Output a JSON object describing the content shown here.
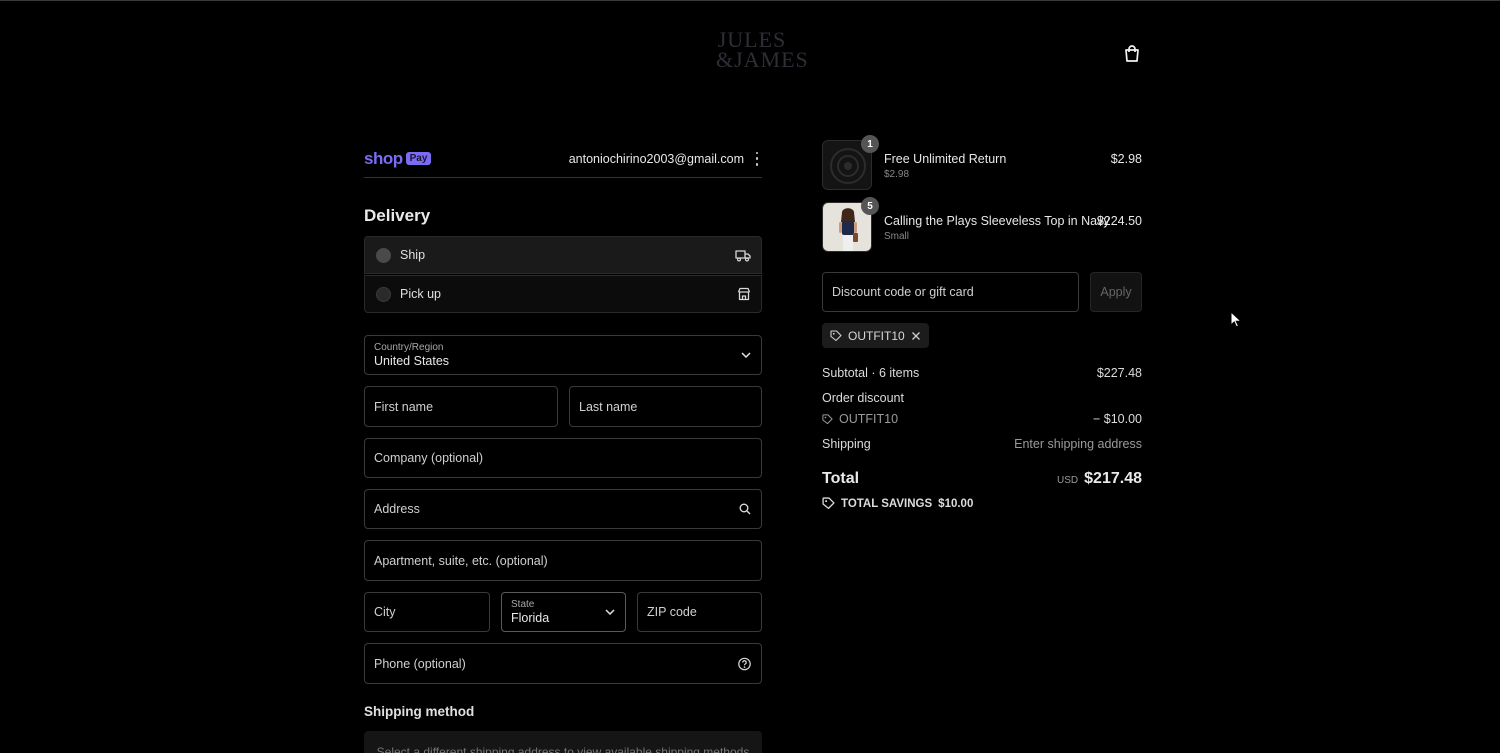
{
  "brand": {
    "logo_line1": "JULES",
    "logo_line2": "&JAMES"
  },
  "header": {
    "cart_icon": "shopping-bag-icon"
  },
  "shop_pay": {
    "word": "shop",
    "badge": "Pay",
    "email": "antoniochirino2003@gmail.com"
  },
  "delivery": {
    "title": "Delivery",
    "options": [
      {
        "label": "Ship",
        "icon": "truck-icon"
      },
      {
        "label": "Pick up",
        "icon": "store-icon"
      }
    ]
  },
  "form": {
    "country": {
      "label": "Country/Region",
      "value": "United States"
    },
    "first_name": "First name",
    "last_name": "Last name",
    "company": "Company (optional)",
    "address": "Address",
    "apartment": "Apartment, suite, etc. (optional)",
    "city": "City",
    "state": {
      "label": "State",
      "value": "Florida"
    },
    "zip": "ZIP code",
    "phone": "Phone (optional)"
  },
  "shipping_method": {
    "title": "Shipping method",
    "message": "Select a different shipping address to view available shipping methods"
  },
  "summary": {
    "items": [
      {
        "qty": "1",
        "name": "Free Unlimited Return",
        "sub": "$2.98",
        "price": "$2.98"
      },
      {
        "qty": "5",
        "name": "Calling the Plays Sleeveless Top in Navy",
        "sub": "Small",
        "price": "$224.50"
      }
    ],
    "discount_placeholder": "Discount code or gift card",
    "apply_label": "Apply",
    "applied_code": "OUTFIT10",
    "subtotal_label": "Subtotal · 6 items",
    "subtotal_value": "$227.48",
    "order_discount_label": "Order discount",
    "discount_code": "OUTFIT10",
    "discount_value": "− $10.00",
    "shipping_label": "Shipping",
    "shipping_value": "Enter shipping address",
    "total_label": "Total",
    "currency": "USD",
    "total_value": "$217.48",
    "savings_label": "TOTAL SAVINGS",
    "savings_value": "$10.00"
  },
  "colors": {
    "accent": "#7b6cf6",
    "background": "#000000"
  }
}
